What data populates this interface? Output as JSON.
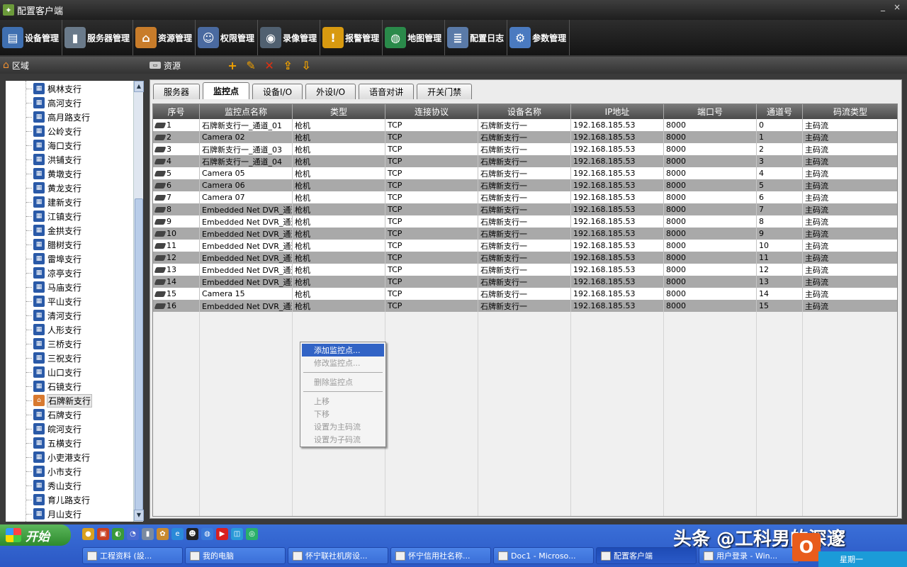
{
  "window": {
    "title": "配置客户端",
    "minimize": "_",
    "close": "×"
  },
  "toolbar": [
    {
      "label": "设备管理",
      "icon": "device-icon",
      "color": "#3f6fb0",
      "glyph": "▤"
    },
    {
      "label": "服务器管理",
      "icon": "server-icon",
      "color": "#6a7a8a",
      "glyph": "▮"
    },
    {
      "label": "资源管理",
      "icon": "home-icon",
      "color": "#c87c2a",
      "glyph": "⌂"
    },
    {
      "label": "权限管理",
      "icon": "user-icon",
      "color": "#4a6aa0",
      "glyph": "☺"
    },
    {
      "label": "录像管理",
      "icon": "film-icon",
      "color": "#506070",
      "glyph": "◉"
    },
    {
      "label": "报警管理",
      "icon": "warning-icon",
      "color": "#d89a10",
      "glyph": "!"
    },
    {
      "label": "地图管理",
      "icon": "globe-icon",
      "color": "#2a8a4a",
      "glyph": "◍"
    },
    {
      "label": "配置日志",
      "icon": "log-icon",
      "color": "#5a7aa8",
      "glyph": "≣"
    },
    {
      "label": "参数管理",
      "icon": "gear-icon",
      "color": "#4a7ac0",
      "glyph": "⚙"
    }
  ],
  "left_panel": {
    "title": "区域",
    "tree": [
      "枫林支行",
      "高河支行",
      "高月路支行",
      "公岭支行",
      "海口支行",
      "洪铺支行",
      "黄墩支行",
      "黄龙支行",
      "建新支行",
      "江镇支行",
      "金拱支行",
      "腊树支行",
      "雷埠支行",
      "凉亭支行",
      "马庙支行",
      "平山支行",
      "清河支行",
      "人形支行",
      "三桥支行",
      "三祝支行",
      "山口支行",
      "石镜支行",
      "石牌新支行",
      "石牌支行",
      "皖河支行",
      "五横支行",
      "小吏港支行",
      "小市支行",
      "秀山支行",
      "育儿路支行",
      "月山支行"
    ],
    "selected_index": 22
  },
  "right_panel": {
    "title": "资源",
    "tools": [
      "add-icon",
      "edit-icon",
      "delete-icon",
      "import-icon",
      "export-icon"
    ]
  },
  "tabs": [
    {
      "label": "服务器",
      "active": false
    },
    {
      "label": "监控点",
      "active": true
    },
    {
      "label": "设备I/O",
      "active": false
    },
    {
      "label": "外设I/O",
      "active": false
    },
    {
      "label": "语音对讲",
      "active": false
    },
    {
      "label": "开关门禁",
      "active": false
    }
  ],
  "table": {
    "columns": [
      "序号",
      "监控点名称",
      "类型",
      "连接协议",
      "设备名称",
      "IP地址",
      "端口号",
      "通道号",
      "码流类型"
    ],
    "rows": [
      [
        "1",
        "石牌新支行一_通道_01",
        "枪机",
        "TCP",
        "石牌新支行一",
        "192.168.185.53",
        "8000",
        "0",
        "主码流"
      ],
      [
        "2",
        "Camera 02",
        "枪机",
        "TCP",
        "石牌新支行一",
        "192.168.185.53",
        "8000",
        "1",
        "主码流"
      ],
      [
        "3",
        "石牌新支行一_通道_03",
        "枪机",
        "TCP",
        "石牌新支行一",
        "192.168.185.53",
        "8000",
        "2",
        "主码流"
      ],
      [
        "4",
        "石牌新支行一_通道_04",
        "枪机",
        "TCP",
        "石牌新支行一",
        "192.168.185.53",
        "8000",
        "3",
        "主码流"
      ],
      [
        "5",
        "Camera 05",
        "枪机",
        "TCP",
        "石牌新支行一",
        "192.168.185.53",
        "8000",
        "4",
        "主码流"
      ],
      [
        "6",
        "Camera 06",
        "枪机",
        "TCP",
        "石牌新支行一",
        "192.168.185.53",
        "8000",
        "5",
        "主码流"
      ],
      [
        "7",
        "Camera 07",
        "枪机",
        "TCP",
        "石牌新支行一",
        "192.168.185.53",
        "8000",
        "6",
        "主码流"
      ],
      [
        "8",
        "Embedded Net DVR_通道_",
        "枪机",
        "TCP",
        "石牌新支行一",
        "192.168.185.53",
        "8000",
        "7",
        "主码流"
      ],
      [
        "9",
        "Embedded Net DVR_通道_",
        "枪机",
        "TCP",
        "石牌新支行一",
        "192.168.185.53",
        "8000",
        "8",
        "主码流"
      ],
      [
        "10",
        "Embedded Net DVR_通道_",
        "枪机",
        "TCP",
        "石牌新支行一",
        "192.168.185.53",
        "8000",
        "9",
        "主码流"
      ],
      [
        "11",
        "Embedded Net DVR_通道_",
        "枪机",
        "TCP",
        "石牌新支行一",
        "192.168.185.53",
        "8000",
        "10",
        "主码流"
      ],
      [
        "12",
        "Embedded Net DVR_通道_",
        "枪机",
        "TCP",
        "石牌新支行一",
        "192.168.185.53",
        "8000",
        "11",
        "主码流"
      ],
      [
        "13",
        "Embedded Net DVR_通道_",
        "枪机",
        "TCP",
        "石牌新支行一",
        "192.168.185.53",
        "8000",
        "12",
        "主码流"
      ],
      [
        "14",
        "Embedded Net DVR_通道_",
        "枪机",
        "TCP",
        "石牌新支行一",
        "192.168.185.53",
        "8000",
        "13",
        "主码流"
      ],
      [
        "15",
        "Camera 15",
        "枪机",
        "TCP",
        "石牌新支行一",
        "192.168.185.53",
        "8000",
        "14",
        "主码流"
      ],
      [
        "16",
        "Embedded Net DVR_通道_",
        "枪机",
        "TCP",
        "石牌新支行一",
        "192.168.185.53",
        "8000",
        "15",
        "主码流"
      ]
    ]
  },
  "context_menu": {
    "items": [
      {
        "label": "添加监控点...",
        "enabled": true,
        "highlighted": true
      },
      {
        "label": "修改监控点...",
        "enabled": false
      },
      {
        "sep": true
      },
      {
        "label": "删除监控点",
        "enabled": false
      },
      {
        "sep": true
      },
      {
        "label": "上移",
        "enabled": false
      },
      {
        "label": "下移",
        "enabled": false
      },
      {
        "label": "设置为主码流",
        "enabled": false
      },
      {
        "label": "设置为子码流",
        "enabled": false
      }
    ]
  },
  "taskbar": {
    "start_label": "开始",
    "tasks": [
      {
        "label": "工程资料 (設...",
        "active": false
      },
      {
        "label": "我的电脑",
        "active": false
      },
      {
        "label": "怀宁联社机房设...",
        "active": false
      },
      {
        "label": "怀宁信用社名称...",
        "active": false
      },
      {
        "label": "Doc1 - Microso...",
        "active": false
      },
      {
        "label": "配置客户端",
        "active": true
      },
      {
        "label": "用户登录 - Win...",
        "active": false
      }
    ],
    "watermark": "头条 @工科男的深邃",
    "office_badge": "O",
    "tray_text": "星期一"
  }
}
